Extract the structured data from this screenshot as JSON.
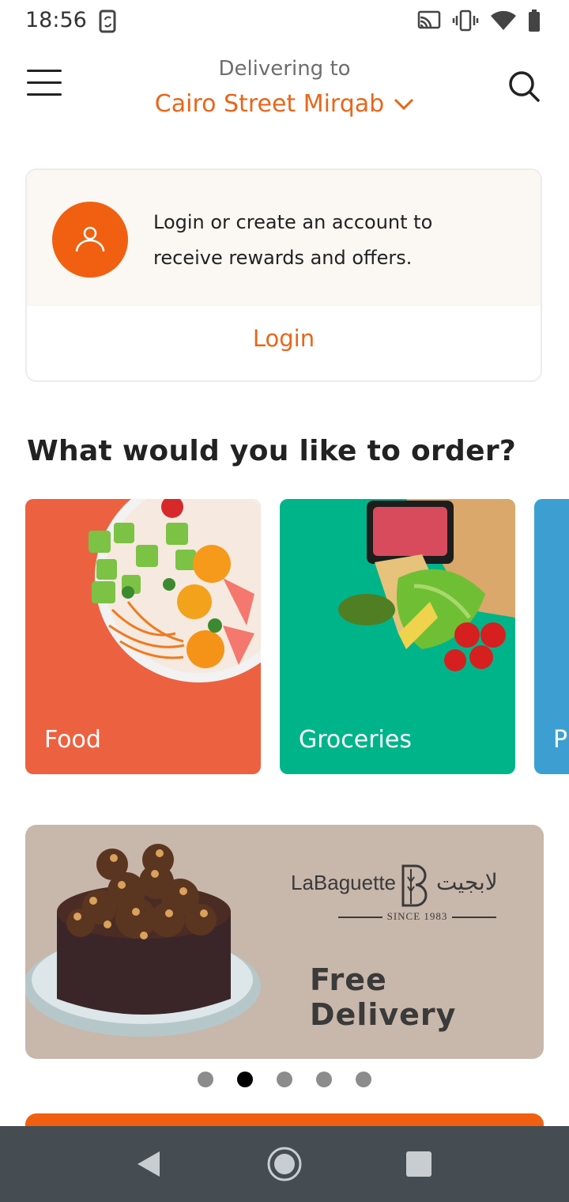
{
  "status_bar": {
    "time": "18:56",
    "icons": [
      "sync-icon",
      "cast-icon",
      "vibrate-icon",
      "wifi-icon",
      "battery-icon"
    ]
  },
  "header": {
    "delivering_label": "Delivering to",
    "location": "Cairo Street Mirqab",
    "icons": [
      "menu-icon",
      "chevron-down-icon",
      "search-icon"
    ]
  },
  "login_card": {
    "message": "Login or create an account to receive rewards and offers.",
    "login_label": "Login",
    "icon": "user-icon"
  },
  "categories": {
    "title": "What would you like to order?",
    "items": [
      {
        "label": "Food",
        "color": "#ec6240"
      },
      {
        "label": "Groceries",
        "color": "#00b48a"
      },
      {
        "label": "P",
        "color": "#3d9fd1"
      }
    ]
  },
  "banner": {
    "brand_name": "LaBaguette",
    "brand_arabic": "لابجيت",
    "since": "SINCE 1983",
    "promo_text": "Free Delivery",
    "background": "#c8b7ab",
    "slide_count": 5,
    "active_slide": 2
  },
  "colors": {
    "accent": "#e8661a",
    "login_bg": "#fbf7f2"
  },
  "nav_bar": {
    "icons": [
      "back-icon",
      "home-icon",
      "recents-icon"
    ]
  }
}
